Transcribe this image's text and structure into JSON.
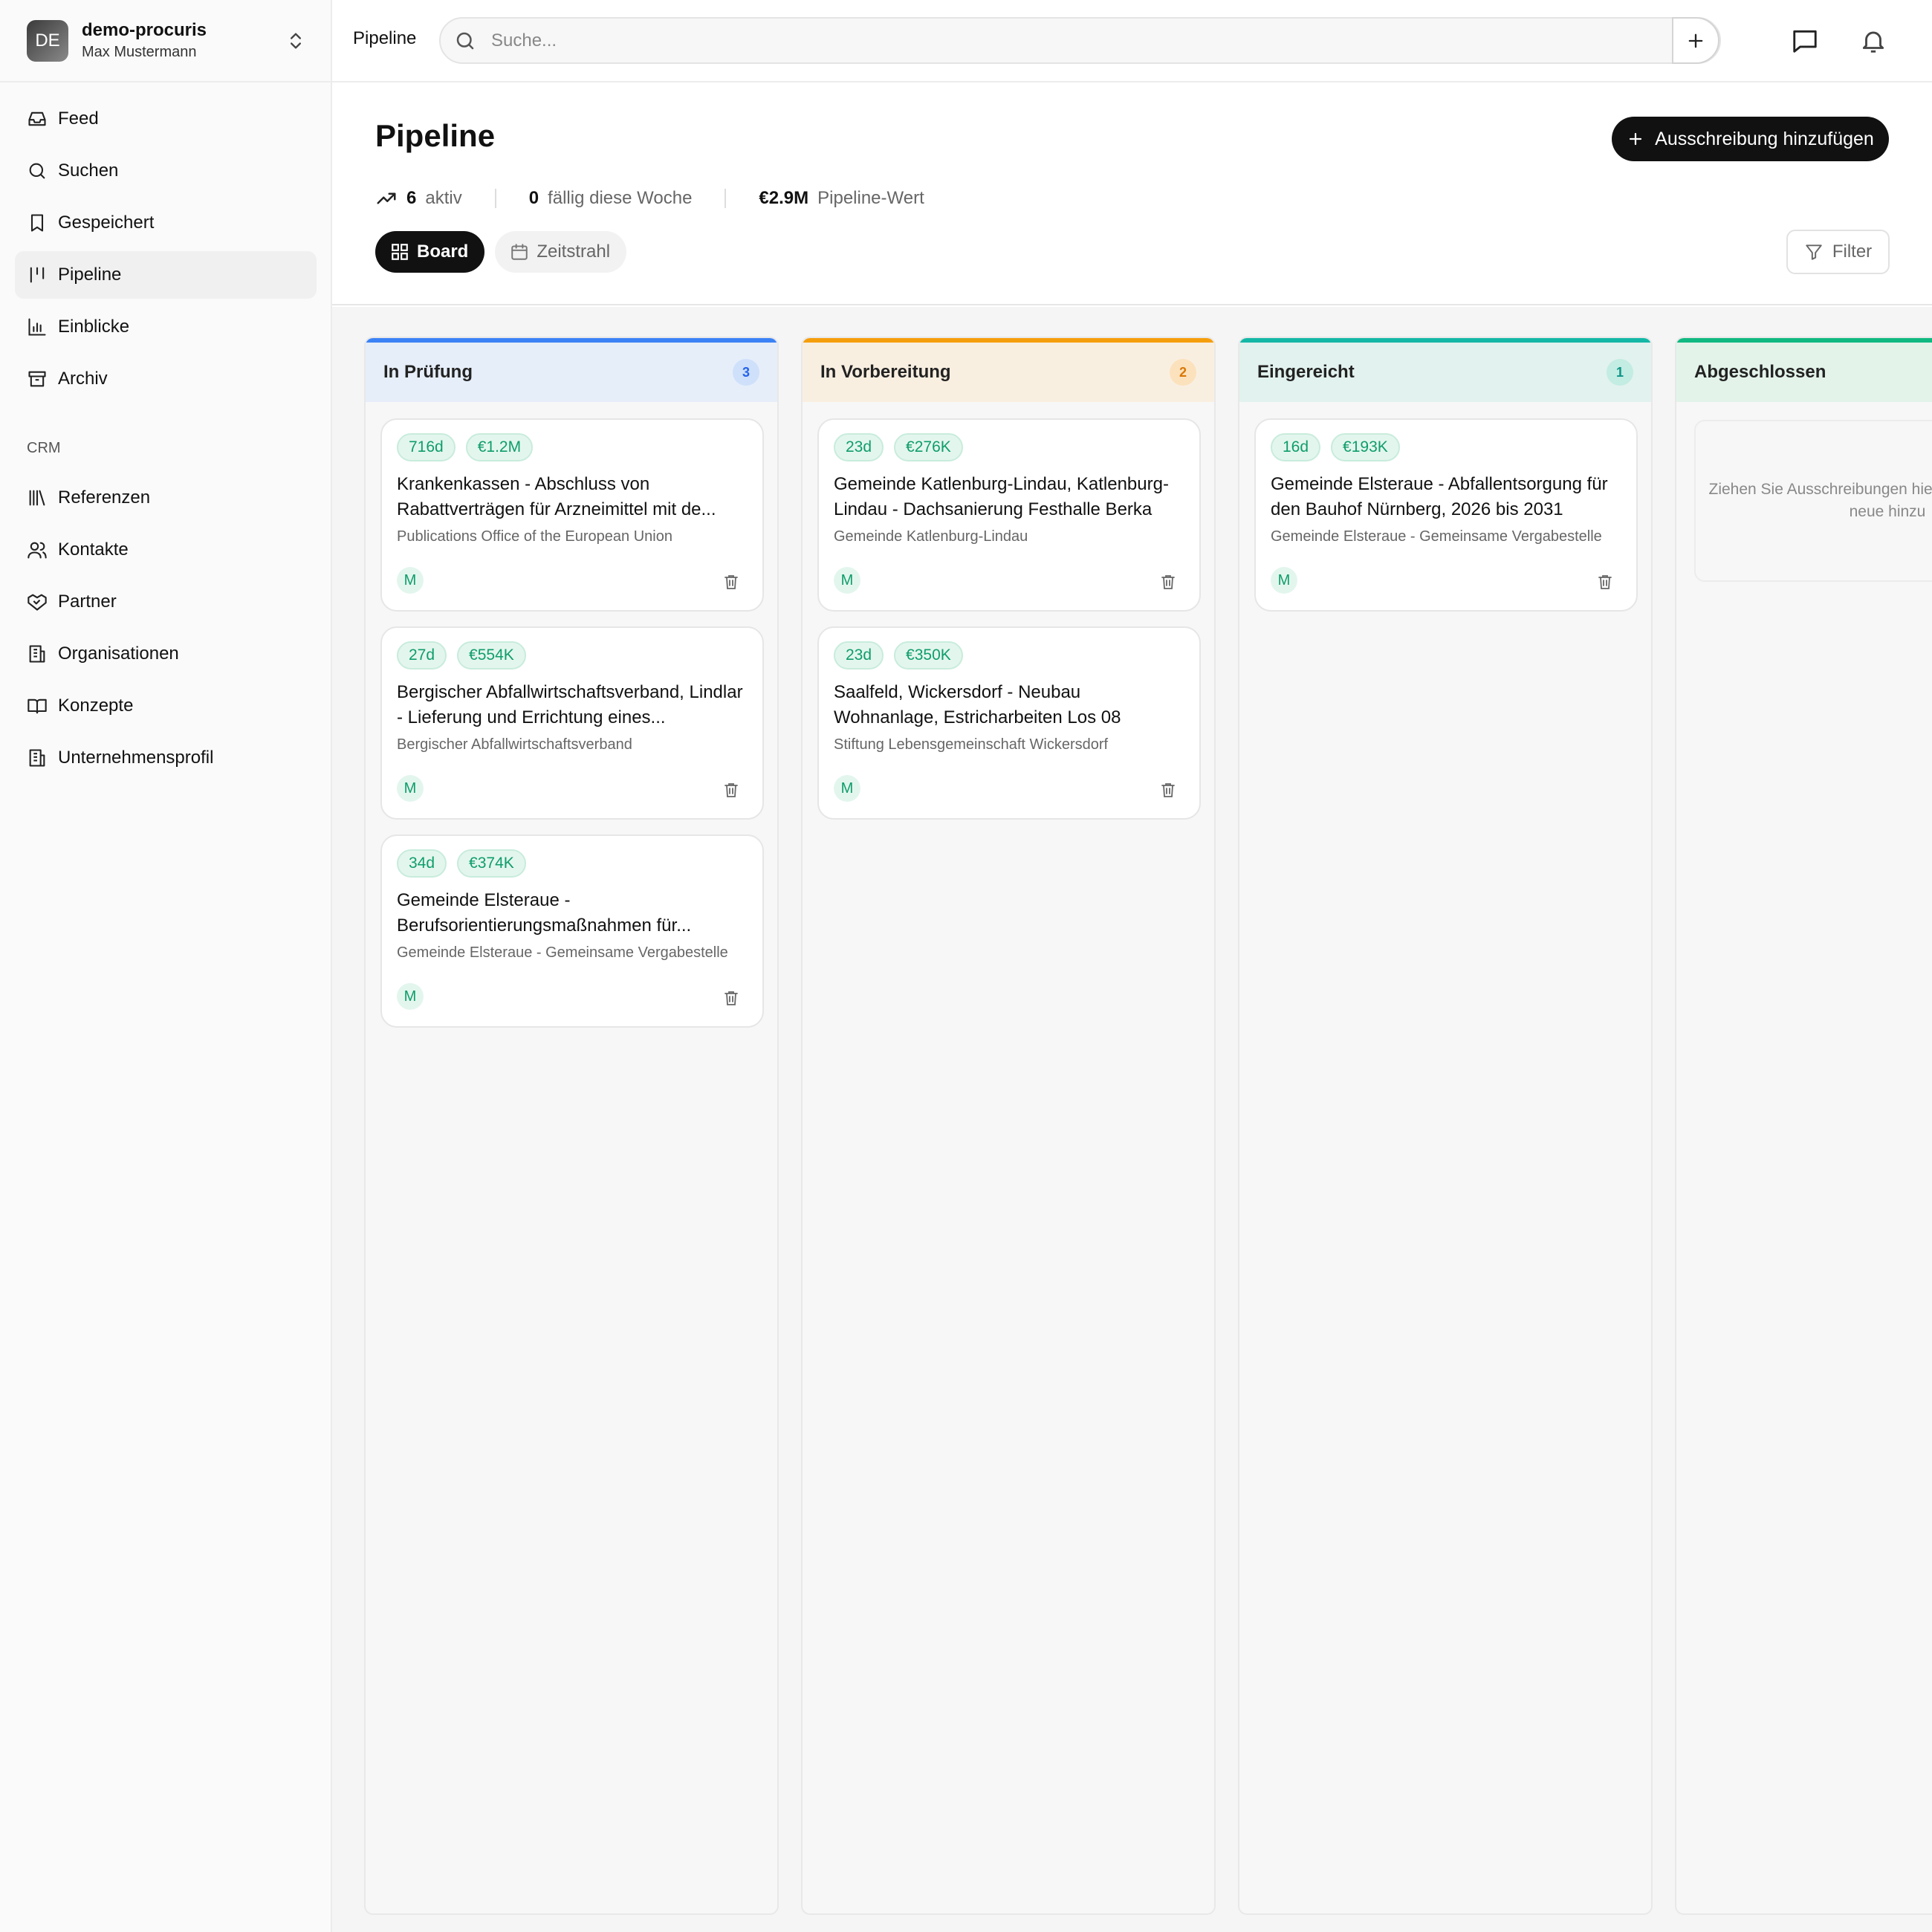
{
  "workspace": {
    "initials": "DE",
    "name": "demo-procuris",
    "user": "Max Mustermann"
  },
  "nav": {
    "items": [
      {
        "label": "Feed",
        "icon": "inbox-icon"
      },
      {
        "label": "Suchen",
        "icon": "search-icon"
      },
      {
        "label": "Gespeichert",
        "icon": "bookmark-icon"
      },
      {
        "label": "Pipeline",
        "icon": "pipeline-icon",
        "active": true
      },
      {
        "label": "Einblicke",
        "icon": "bar-chart-icon"
      },
      {
        "label": "Archiv",
        "icon": "archive-icon"
      }
    ],
    "crm_label": "CRM",
    "crm_items": [
      {
        "label": "Referenzen",
        "icon": "library-icon"
      },
      {
        "label": "Kontakte",
        "icon": "users-icon"
      },
      {
        "label": "Partner",
        "icon": "handshake-icon"
      },
      {
        "label": "Organisationen",
        "icon": "building-icon"
      },
      {
        "label": "Konzepte",
        "icon": "book-open-icon"
      },
      {
        "label": "Unternehmensprofil",
        "icon": "building-icon"
      }
    ]
  },
  "topbar": {
    "breadcrumb": "Pipeline",
    "search_placeholder": "Suche..."
  },
  "header": {
    "title": "Pipeline",
    "add_button": "Ausschreibung hinzufügen",
    "stats": {
      "active_value": "6",
      "active_label": "aktiv",
      "due_value": "0",
      "due_label": "fällig diese Woche",
      "pipeline_value": "€2.9M",
      "pipeline_label": "Pipeline-Wert"
    },
    "tabs": {
      "board": "Board",
      "timeline": "Zeitstrahl"
    },
    "filter": "Filter"
  },
  "columns": [
    {
      "title": "In Prüfung",
      "count": "3",
      "accent": "#3b82f6",
      "cards": [
        {
          "days": "716d",
          "value": "€1.2M",
          "title": "Krankenkassen - Abschluss von Rabattverträgen für Arzneimittel mit de...",
          "org": "Publications Office of the European Union",
          "avatar": "M"
        },
        {
          "days": "27d",
          "value": "€554K",
          "title": "Bergischer Abfallwirtschaftsverband, Lindlar - Lieferung und Errichtung eines...",
          "org": "Bergischer Abfallwirtschaftsverband",
          "avatar": "M"
        },
        {
          "days": "34d",
          "value": "€374K",
          "title": "Gemeinde Elsteraue - Berufsorientierungsmaßnahmen für...",
          "org": "Gemeinde Elsteraue - Gemeinsame Vergabestelle",
          "avatar": "M"
        }
      ]
    },
    {
      "title": "In Vorbereitung",
      "count": "2",
      "accent": "#f59e0b",
      "cards": [
        {
          "days": "23d",
          "value": "€276K",
          "title": "Gemeinde Katlenburg-Lindau, Katlenburg-Lindau - Dachsanierung Festhalle Berka",
          "org": "Gemeinde Katlenburg-Lindau",
          "avatar": "M"
        },
        {
          "days": "23d",
          "value": "€350K",
          "title": "Saalfeld, Wickersdorf - Neubau Wohnanlage, Estricharbeiten Los 08",
          "org": "Stiftung Lebensgemeinschaft Wickersdorf",
          "avatar": "M"
        }
      ]
    },
    {
      "title": "Eingereicht",
      "count": "1",
      "accent": "#14b8a6",
      "cards": [
        {
          "days": "16d",
          "value": "€193K",
          "title": "Gemeinde Elsteraue - Abfallentsorgung für den Bauhof Nürnberg, 2026 bis 2031",
          "org": "Gemeinde Elsteraue - Gemeinsame Vergabestelle",
          "avatar": "M"
        }
      ]
    },
    {
      "title": "Abgeschlossen",
      "accent": "#10b981",
      "empty_text": "Ziehen Sie Ausschreibungen hierher oder fügen Sie neue hinzu"
    }
  ]
}
